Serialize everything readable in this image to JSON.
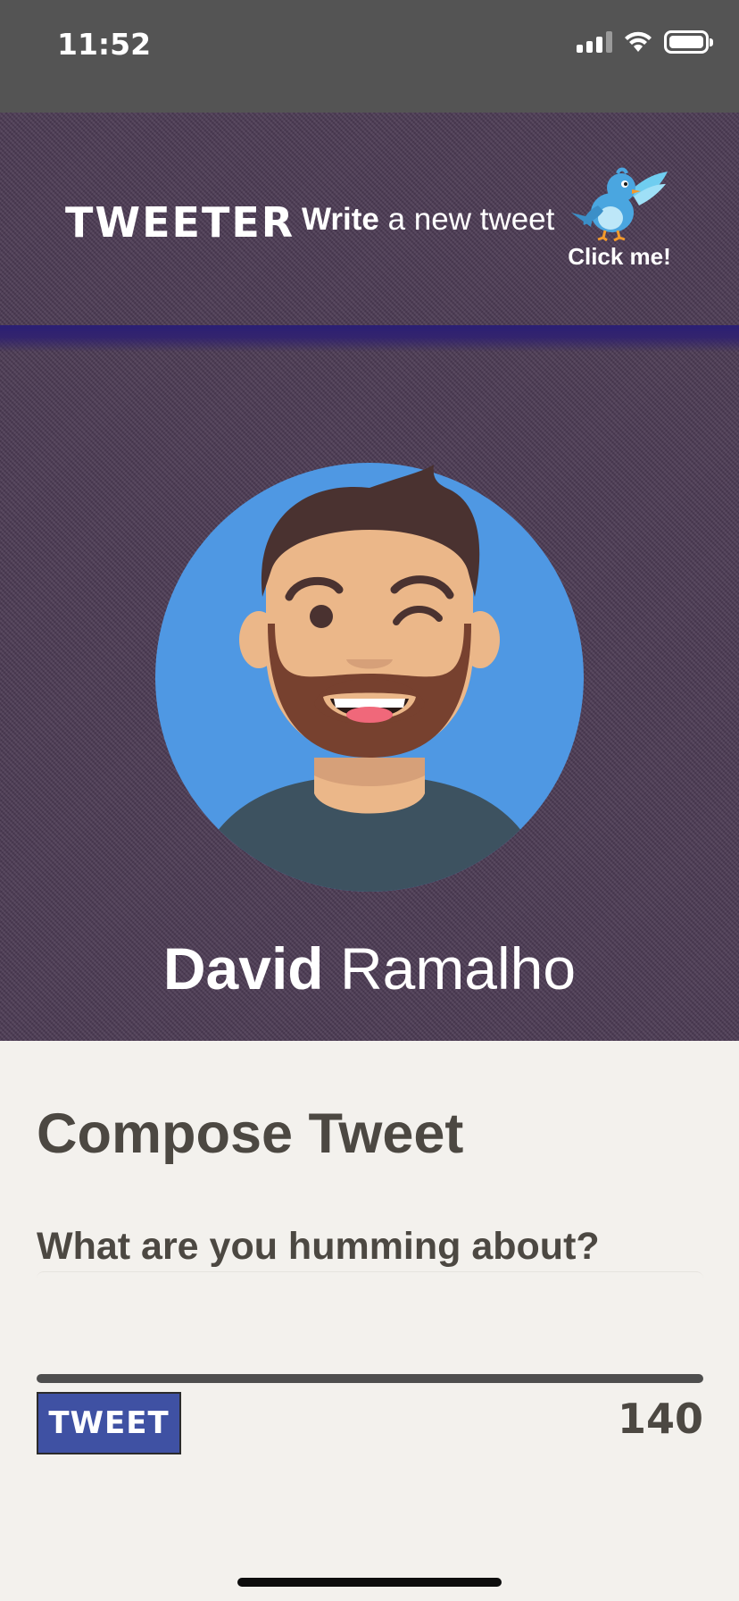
{
  "status_bar": {
    "time": "11:52",
    "icons": [
      "cellular-signal-icon",
      "wifi-icon",
      "battery-icon"
    ]
  },
  "header": {
    "logo": "TWEETER",
    "tagline_bold": "Write",
    "tagline_rest": " a new tweet",
    "bird_button_label": "Click me!",
    "bird_icon": "bird-icon"
  },
  "profile": {
    "first_name": "David",
    "last_name": " Ramalho",
    "avatar_icon": "avatar-illustration"
  },
  "compose": {
    "title": "Compose Tweet",
    "prompt": "What are you humming about?",
    "input_value": "",
    "input_placeholder": "",
    "submit_label": "TWEET",
    "char_count": "140"
  },
  "colors": {
    "status_bar_bg": "#545454",
    "hero_bg": "#4b3a53",
    "divider": "#2b1f74",
    "compose_bg": "#f3f1ed",
    "text_dark": "#4c4842",
    "button_bg": "#3f51a3",
    "avatar_circle": "#4f98e3"
  }
}
